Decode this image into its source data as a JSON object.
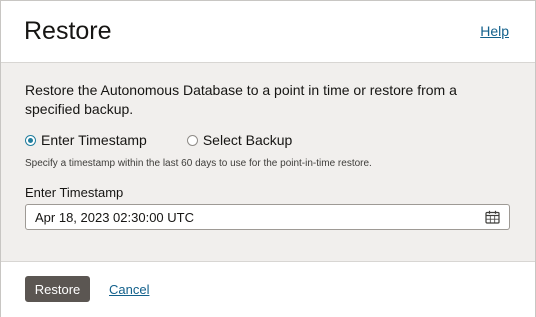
{
  "dialog": {
    "title": "Restore",
    "help_label": "Help"
  },
  "body": {
    "description": "Restore the Autonomous Database to a point in time or restore from a specified backup.",
    "restore_mode": {
      "options": [
        {
          "label": "Enter Timestamp",
          "selected": true
        },
        {
          "label": "Select Backup",
          "selected": false
        }
      ]
    },
    "hint": "Specify a timestamp within the last 60 days to use for the point-in-time restore.",
    "timestamp_field": {
      "label": "Enter Timestamp",
      "value": "Apr 18, 2023 02:30:00 UTC",
      "icon": "calendar-icon"
    }
  },
  "footer": {
    "restore_label": "Restore",
    "cancel_label": "Cancel"
  },
  "colors": {
    "link": "#13618c",
    "radio_selected": "#227e9e",
    "primary_button": "#5b5652",
    "body_background": "#f1efed"
  }
}
